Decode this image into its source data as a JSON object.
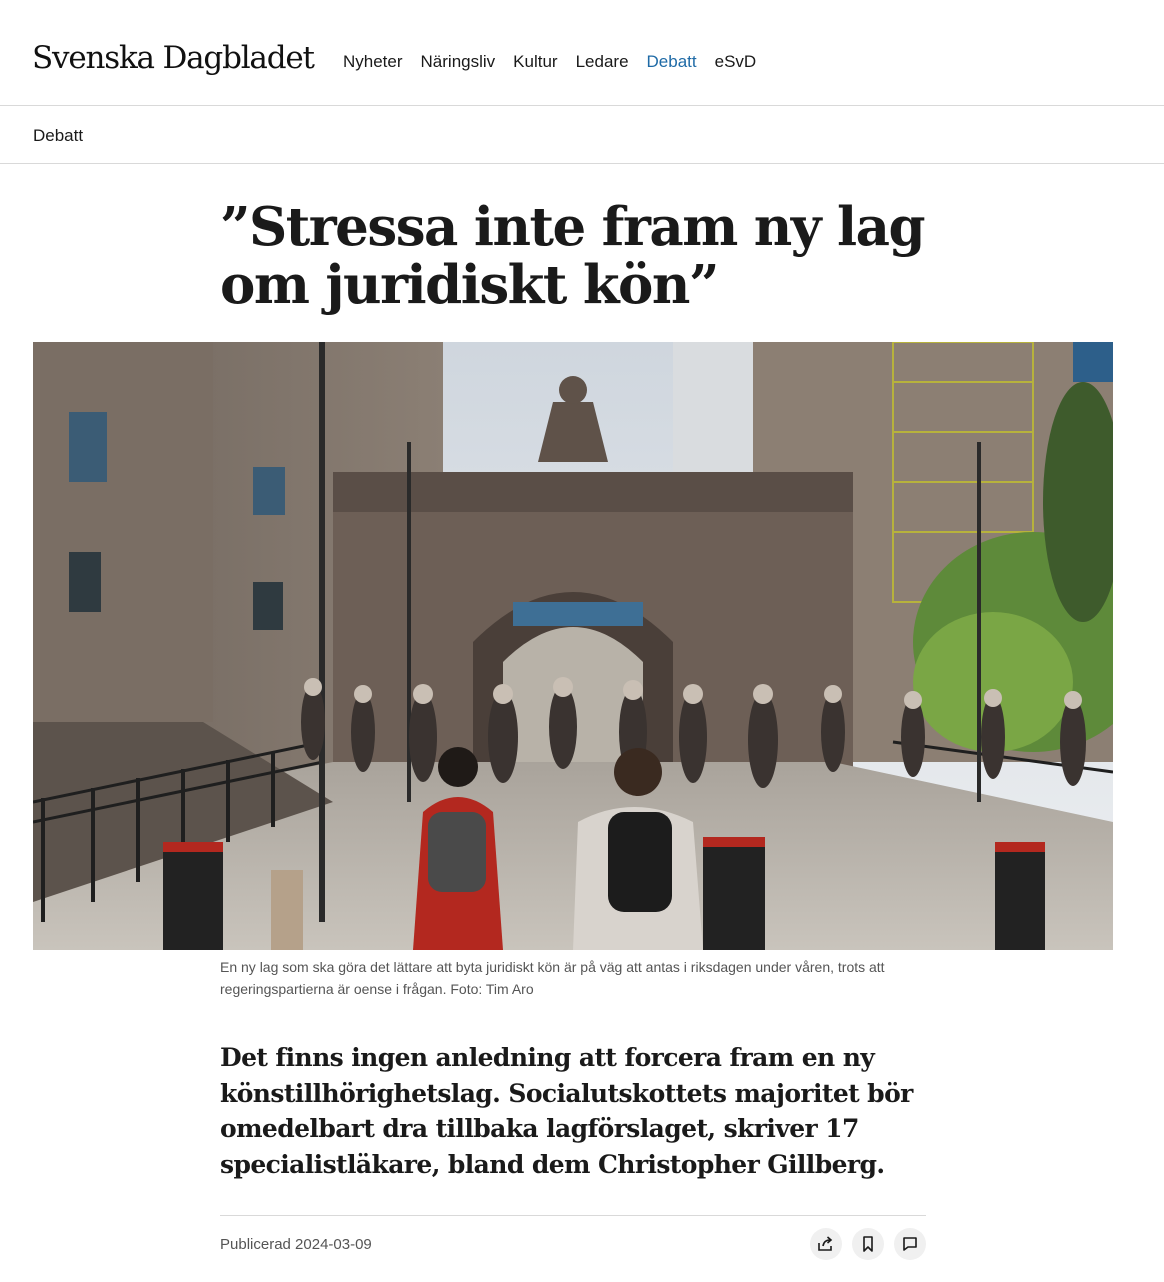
{
  "site": {
    "logo": "Svenska Dagbladet"
  },
  "nav": {
    "items": [
      {
        "label": "Nyheter"
      },
      {
        "label": "Näringsliv"
      },
      {
        "label": "Kultur"
      },
      {
        "label": "Ledare"
      },
      {
        "label": "Debatt",
        "active": true
      },
      {
        "label": "eSvD"
      }
    ],
    "active_color": "#1e6aa6"
  },
  "section": {
    "label": "Debatt"
  },
  "article": {
    "headline": "”Stressa inte fram ny lag om juridiskt kön”",
    "caption": "En ny lag som ska göra det lättare att byta juridiskt kön är på väg att antas i riksdagen under våren, trots att regeringspartierna är oense i frågan. Foto: Tim Aro",
    "lead": "Det finns ingen anledning att forcera fram en ny könstillhörighetslag. Socialutskottets majoritet bör omedelbart dra tillbaka lagförslaget, skriver 17 specialistläkare, bland dem Christopher Gillberg.",
    "published": "Publicerad 2024-03-09"
  },
  "actions": [
    {
      "icon": "share-icon"
    },
    {
      "icon": "bookmark-icon"
    },
    {
      "icon": "comment-icon"
    }
  ]
}
